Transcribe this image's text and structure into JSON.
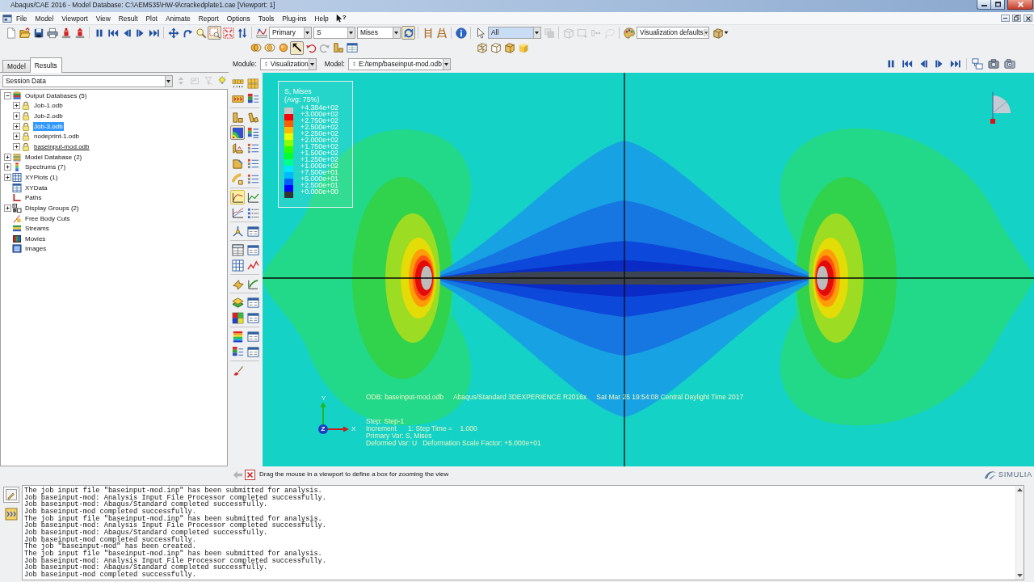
{
  "window": {
    "title": "Abaqus/CAE 2016 - Model Database: C:\\AEM535\\HW-9\\crackedplate1.cae [Viewport: 1]"
  },
  "menu": {
    "items": [
      "File",
      "Model",
      "Viewport",
      "View",
      "Result",
      "Plot",
      "Animate",
      "Report",
      "Options",
      "Tools",
      "Plug-ins",
      "Help"
    ],
    "context_help": "?"
  },
  "toolbar": [
    [
      {
        "kind": "new",
        "pressed": false,
        "disabled": false
      },
      {
        "kind": "open",
        "pressed": false,
        "disabled": false
      },
      {
        "kind": "save",
        "pressed": false,
        "disabled": false
      },
      {
        "kind": "print",
        "pressed": false,
        "disabled": false
      },
      {
        "kind": "stamp",
        "pressed": false,
        "disabled": false
      },
      {
        "kind": "stamp-up",
        "pressed": false,
        "disabled": false
      }
    ],
    [
      {
        "kind": "pause",
        "pressed": false,
        "disabled": false
      },
      {
        "kind": "first",
        "pressed": false,
        "disabled": false
      },
      {
        "kind": "prev",
        "pressed": false,
        "disabled": false
      },
      {
        "kind": "next",
        "pressed": false,
        "disabled": false
      },
      {
        "kind": "last",
        "pressed": false,
        "disabled": false
      }
    ],
    [
      {
        "kind": "pan",
        "pressed": false,
        "disabled": false
      },
      {
        "kind": "rotate",
        "pressed": false,
        "disabled": false
      },
      {
        "kind": "magnify",
        "pressed": false,
        "disabled": false
      },
      {
        "kind": "zoom-box",
        "pressed": true,
        "disabled": false
      },
      {
        "kind": "fit",
        "pressed": false,
        "disabled": false
      },
      {
        "kind": "swap",
        "pressed": false,
        "disabled": false
      }
    ],
    [
      {
        "kind": "field",
        "pressed": false,
        "disabled": false
      },
      {
        "kind": "combo",
        "value": "Primary",
        "highlighted": false
      },
      {
        "kind": "combo",
        "value": "S",
        "highlighted": false
      },
      {
        "kind": "combo",
        "value": "Mises",
        "highlighted": false
      },
      {
        "kind": "sync",
        "pressed": true,
        "disabled": false
      }
    ],
    [
      {
        "kind": "ladder",
        "pressed": false,
        "disabled": false
      },
      {
        "kind": "ladder-slant",
        "pressed": false,
        "disabled": false
      }
    ],
    [
      {
        "kind": "info",
        "pressed": false,
        "disabled": false
      }
    ],
    [
      {
        "kind": "pointer",
        "pressed": false,
        "disabled": false
      },
      {
        "kind": "combo",
        "value": "All",
        "highlighted": true
      },
      {
        "kind": "stack",
        "pressed": false,
        "disabled": true
      }
    ],
    [
      {
        "kind": "cube-outline",
        "pressed": false,
        "disabled": true
      },
      {
        "kind": "box-select",
        "pressed": false,
        "disabled": true
      },
      {
        "kind": "dots",
        "pressed": false,
        "disabled": true
      },
      {
        "kind": "lasso",
        "pressed": false,
        "disabled": true
      }
    ],
    [
      {
        "kind": "palette",
        "pressed": false,
        "disabled": false
      },
      {
        "kind": "combo",
        "value": "Visualization defaults",
        "highlighted": false
      },
      {
        "kind": "cube-menu"
      }
    ]
  ],
  "toolbar_row2": [
    [
      {
        "kind": "venn",
        "pressed": false,
        "disabled": false
      },
      {
        "kind": "venn2",
        "pressed": false,
        "disabled": false
      },
      {
        "kind": "sphere",
        "pressed": false,
        "disabled": false
      },
      {
        "kind": "pick",
        "pressed": true,
        "disabled": false
      },
      {
        "kind": "undo",
        "pressed": false,
        "disabled": false
      },
      {
        "kind": "redo",
        "pressed": false,
        "disabled": true
      },
      {
        "kind": "blocks",
        "pressed": false,
        "disabled": false
      },
      {
        "kind": "win-table",
        "pressed": false,
        "disabled": false
      }
    ],
    [
      {
        "kind": "cube-wire"
      },
      {
        "kind": "cube-hidden"
      },
      {
        "kind": "cube-shade"
      },
      {
        "kind": "cube-solid"
      }
    ]
  ],
  "left_tabs": [
    {
      "label": "Model",
      "selected": false
    },
    {
      "label": "Results",
      "selected": true
    }
  ],
  "module": {
    "label": "Module:",
    "value": "Visualization"
  },
  "model": {
    "label": "Model:",
    "value": "E:/temp/baseinput-mod.odb"
  },
  "animation": [
    [
      {
        "kind": "pause"
      },
      {
        "kind": "first"
      },
      {
        "kind": "prev"
      },
      {
        "kind": "next"
      },
      {
        "kind": "last"
      }
    ],
    [
      {
        "kind": "layout"
      },
      {
        "kind": "camera"
      },
      {
        "kind": "camera2"
      }
    ]
  ],
  "session": {
    "value": "Session Data",
    "tools": [
      {
        "kind": "spin",
        "disabled": true
      },
      {
        "kind": "parent",
        "disabled": true
      },
      {
        "kind": "filter",
        "disabled": true
      },
      {
        "kind": "bulb",
        "disabled": false
      }
    ]
  },
  "tree": [
    {
      "label": "Output Databases (5)",
      "kind": "databases",
      "expanded": true,
      "selected": false,
      "children": [
        {
          "label": "Job-1.odb",
          "kind": "odb",
          "expanded": false,
          "selected": false,
          "current": false
        },
        {
          "label": "Job-2.odb",
          "kind": "odb",
          "expanded": false,
          "selected": false,
          "current": false
        },
        {
          "label": "Job-3.odb",
          "kind": "odb",
          "expanded": false,
          "selected": true,
          "current": false
        },
        {
          "label": "nodeprint-1.odb",
          "kind": "odb",
          "expanded": false,
          "selected": false,
          "current": false
        },
        {
          "label": "baseinput-mod.odb",
          "kind": "odb",
          "expanded": false,
          "selected": false,
          "current": true
        }
      ]
    },
    {
      "label": "Model Database (2)",
      "kind": "models",
      "expanded": false,
      "selected": false
    },
    {
      "label": "Spectrums (7)",
      "kind": "spectrum",
      "expanded": false,
      "selected": false
    },
    {
      "label": "XYPlots (1)",
      "kind": "plots",
      "expanded": false,
      "selected": false
    },
    {
      "label": "XYData",
      "kind": "table",
      "selected": false
    },
    {
      "label": "Paths",
      "kind": "path",
      "selected": false
    },
    {
      "label": "Display Groups (2)",
      "kind": "groups",
      "expanded": false,
      "selected": false
    },
    {
      "label": "Free Body Cuts",
      "kind": "cuts",
      "selected": false
    },
    {
      "label": "Streams",
      "kind": "streams",
      "selected": false
    },
    {
      "label": "Movies",
      "kind": "movies",
      "selected": false
    },
    {
      "label": "Images",
      "kind": "images",
      "selected": false
    }
  ],
  "toolbox": [
    [
      {
        "kind": "tiles-num",
        "pressed": false,
        "highlighted": false
      },
      {
        "kind": "tiles",
        "pressed": false,
        "highlighted": false
      },
      {
        "kind": "tiles-arrow",
        "pressed": false,
        "highlighted": false
      },
      {
        "kind": "stack-list",
        "pressed": false,
        "highlighted": false
      }
    ],
    [
      {
        "kind": "blocks",
        "pressed": false,
        "highlighted": false
      },
      {
        "kind": "blocks-tilt",
        "pressed": false,
        "highlighted": false
      },
      {
        "kind": "contour",
        "pressed": true,
        "highlighted": false
      },
      {
        "kind": "color-list",
        "pressed": false,
        "highlighted": false
      },
      {
        "kind": "symbol",
        "pressed": false,
        "highlighted": false
      },
      {
        "kind": "list",
        "pressed": false,
        "highlighted": false
      },
      {
        "kind": "material",
        "pressed": false,
        "highlighted": false
      },
      {
        "kind": "list",
        "pressed": false,
        "highlighted": false
      },
      {
        "kind": "deform",
        "pressed": false,
        "highlighted": false
      },
      {
        "kind": "list",
        "pressed": false,
        "highlighted": false
      }
    ],
    [
      {
        "kind": "xy-curve",
        "pressed": false,
        "highlighted": true
      },
      {
        "kind": "xy-curve2",
        "pressed": false,
        "highlighted": false
      },
      {
        "kind": "xy-multi",
        "pressed": false,
        "highlighted": false
      },
      {
        "kind": "dot-list",
        "pressed": false,
        "highlighted": false
      }
    ],
    [
      {
        "kind": "triad",
        "pressed": false,
        "highlighted": false
      },
      {
        "kind": "window",
        "pressed": false,
        "highlighted": false
      }
    ],
    [
      {
        "kind": "xy-table",
        "pressed": false,
        "highlighted": false
      },
      {
        "kind": "window",
        "pressed": false,
        "highlighted": false
      },
      {
        "kind": "grid",
        "pressed": false,
        "highlighted": false
      },
      {
        "kind": "line-graph",
        "pressed": false,
        "highlighted": false
      }
    ],
    [
      {
        "kind": "arrow-shape",
        "pressed": false,
        "highlighted": false
      },
      {
        "kind": "chart",
        "pressed": false,
        "highlighted": false
      }
    ],
    [
      {
        "kind": "layers",
        "pressed": false,
        "highlighted": false
      },
      {
        "kind": "window",
        "pressed": false,
        "highlighted": false
      },
      {
        "kind": "color-grid",
        "pressed": false,
        "highlighted": false
      },
      {
        "kind": "window",
        "pressed": false,
        "highlighted": false
      }
    ],
    [
      {
        "kind": "rainbow",
        "pressed": false,
        "highlighted": false
      },
      {
        "kind": "window",
        "pressed": false,
        "highlighted": false
      },
      {
        "kind": "stack-list",
        "pressed": false,
        "highlighted": false
      },
      {
        "kind": "window",
        "pressed": false,
        "highlighted": false
      }
    ],
    [
      {
        "kind": "brush",
        "pressed": false,
        "highlighted": false
      }
    ]
  ],
  "viewport": {
    "legend": {
      "title": "S, Mises",
      "subtitle": "(Avg: 75%)",
      "items": [
        {
          "label": "+4.384e+02",
          "color": "#c8c8c8"
        },
        {
          "label": "+3.000e+02",
          "color": "#ff0000"
        },
        {
          "label": "+2.750e+02",
          "color": "#ff5d00"
        },
        {
          "label": "+2.500e+02",
          "color": "#ffb900"
        },
        {
          "label": "+2.250e+02",
          "color": "#e8ff00"
        },
        {
          "label": "+2.000e+02",
          "color": "#8bff00"
        },
        {
          "label": "+1.750e+02",
          "color": "#2eff00"
        },
        {
          "label": "+1.500e+02",
          "color": "#00ff2e"
        },
        {
          "label": "+1.250e+02",
          "color": "#00ff8b"
        },
        {
          "label": "+1.000e+02",
          "color": "#00e8ff"
        },
        {
          "label": "+7.500e+01",
          "color": "#00b9ff"
        },
        {
          "label": "+5.000e+01",
          "color": "#005dff"
        },
        {
          "label": "+2.500e+01",
          "color": "#0000ff"
        },
        {
          "label": "+0.000e+00",
          "color": "#333333"
        }
      ]
    },
    "info": [
      "ODB: baseinput-mod.odb",
      "Abaqus/Standard 3DEXPERIENCE R2016x",
      "Sat Mar 25 19:54:08 Central Daylight Time 2017"
    ],
    "state": [
      "Step: Step-1",
      "Increment      1: Step Time =    1.000",
      "Primary Var: S, Mises",
      "Deformed Var: U   Deformation Scale Factor: +5.000e+01"
    ],
    "triad": {
      "x": "X",
      "y": "Y",
      "z": "Z"
    }
  },
  "prompt": {
    "back_disabled": true,
    "text": "Drag the mouse in a viewport to define a box for zooming the view"
  },
  "logo": "SIMULIA",
  "console": {
    "tabs": [
      {
        "kind": "messages",
        "selected": true
      },
      {
        "kind": "command",
        "selected": false
      }
    ],
    "lines": [
      "The job input file \"baseinput-mod.inp\" has been submitted for analysis.",
      "Job baseinput-mod: Analysis Input File Processor completed successfully.",
      "Job baseinput-mod: Abaqus/Standard completed successfully.",
      "Job baseinput-mod completed successfully.",
      "The job input file \"baseinput-mod.inp\" has been submitted for analysis.",
      "Job baseinput-mod: Analysis Input File Processor completed successfully.",
      "Job baseinput-mod: Abaqus/Standard completed successfully.",
      "Job baseinput-mod completed successfully.",
      "The job \"baseinput-mod\" has been created.",
      "The job input file \"baseinput-mod.inp\" has been submitted for analysis.",
      "Job baseinput-mod: Analysis Input File Processor completed successfully.",
      "Job baseinput-mod: Abaqus/Standard completed successfully.",
      "Job baseinput-mod completed successfully."
    ]
  }
}
